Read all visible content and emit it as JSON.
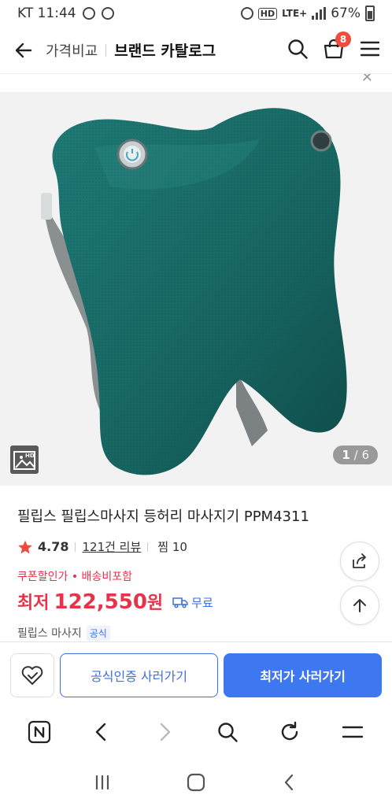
{
  "status_bar": {
    "carrier_time": "KT 11:44",
    "hd": "HD",
    "network": "LTE+",
    "battery": "67%"
  },
  "header": {
    "compare_label": "가격비교",
    "title": "브랜드 카탈로그",
    "cart_count": "8"
  },
  "product": {
    "image_pager_current": "1",
    "image_pager_total": "/ 6",
    "hd_badge": "HD",
    "name": "필립스 필립스마사지 등허리 마사지기 PPM4311",
    "rating": "4.78",
    "reviews": "121건 리뷰",
    "zzim": "찜 10",
    "coupon_text": "쿠폰할인가 • 배송비포함",
    "price_label": "최저",
    "price": "122,550",
    "price_unit": "원",
    "shipping": "무료",
    "store_name": "필립스 마사지",
    "store_badge": "공식"
  },
  "actions": {
    "official_button": "공식인증 사러가기",
    "lowest_button": "최저가 사러가기"
  },
  "colors": {
    "accent_red": "#e8324a",
    "accent_blue": "#3d78f0",
    "product_teal": "#1e6e6a"
  }
}
